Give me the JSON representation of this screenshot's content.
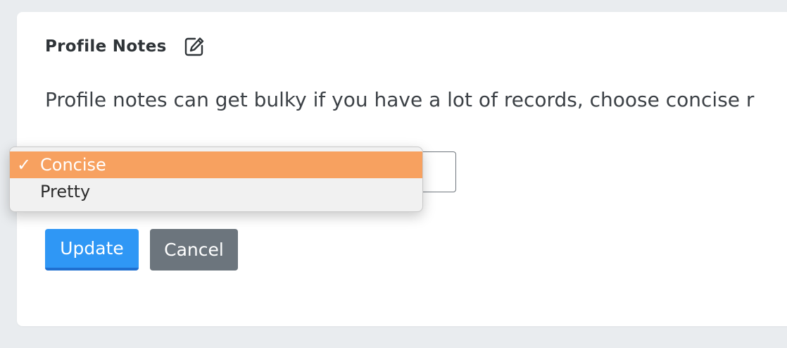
{
  "card": {
    "title": "Profile Notes",
    "edit_icon": "edit-icon",
    "description": "Profile notes can get bulky if you have a lot of records, choose concise r"
  },
  "select": {
    "selected_value": "Concise",
    "options": [
      {
        "label": "Concise",
        "selected": true,
        "check": "✓"
      },
      {
        "label": "Pretty",
        "selected": false,
        "check": ""
      }
    ]
  },
  "buttons": {
    "update_label": "Update",
    "cancel_label": "Cancel"
  },
  "colors": {
    "background": "#e9ecef",
    "card": "#ffffff",
    "option_highlight": "#f7a160",
    "primary": "#2f97f5",
    "secondary": "#6c757d"
  }
}
